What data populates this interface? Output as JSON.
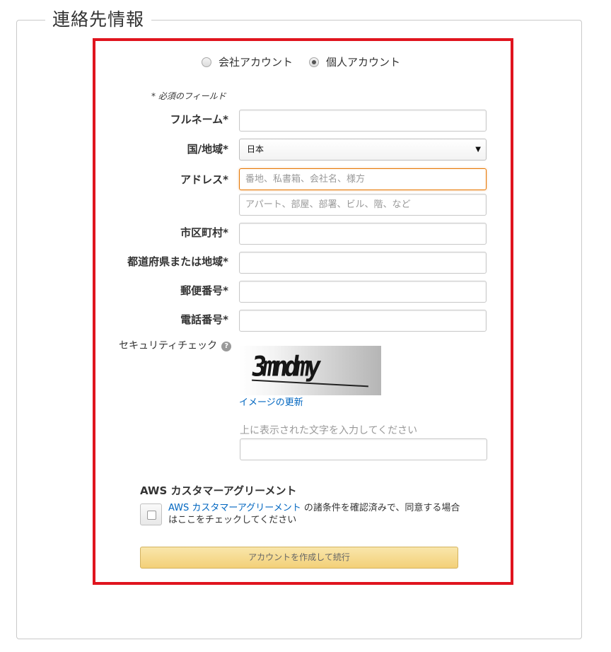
{
  "section": {
    "title": "連絡先情報"
  },
  "account_type": {
    "options": [
      {
        "label": "会社アカウント",
        "checked": false
      },
      {
        "label": "個人アカウント",
        "checked": true
      }
    ]
  },
  "form": {
    "required_note": "* 必須のフィールド",
    "full_name": {
      "label": "フルネーム*",
      "value": ""
    },
    "country": {
      "label": "国/地域*",
      "selected": "日本"
    },
    "address": {
      "label": "アドレス*",
      "line1_placeholder": "番地、私書箱、会社名、様方",
      "line2_placeholder": "アパート、部屋、部署、ビル、階、など"
    },
    "city": {
      "label": "市区町村*",
      "value": ""
    },
    "state": {
      "label": "都道府県または地域*",
      "value": ""
    },
    "postal": {
      "label": "郵便番号*",
      "value": ""
    },
    "phone": {
      "label": "電話番号*",
      "value": ""
    }
  },
  "security": {
    "label": "セキュリティチェック",
    "help_icon": "question-circle-icon",
    "captcha_text": "3mndmy",
    "refresh_label": "イメージの更新",
    "hint": "上に表示された文字を入力してください",
    "value": ""
  },
  "agreement": {
    "title": "AWS カスタマーアグリーメント",
    "link_text": "AWS カスタマーアグリーメント",
    "text_after_link": " の諸条件を確認済みで、同意する場合はここをチェックしてください",
    "checked": false
  },
  "submit": {
    "label": "アカウントを作成して続行"
  },
  "colors": {
    "highlight_border": "#e0141e",
    "link": "#0066c0",
    "button_bg": "#f3d078",
    "focus_border": "#e77600"
  }
}
